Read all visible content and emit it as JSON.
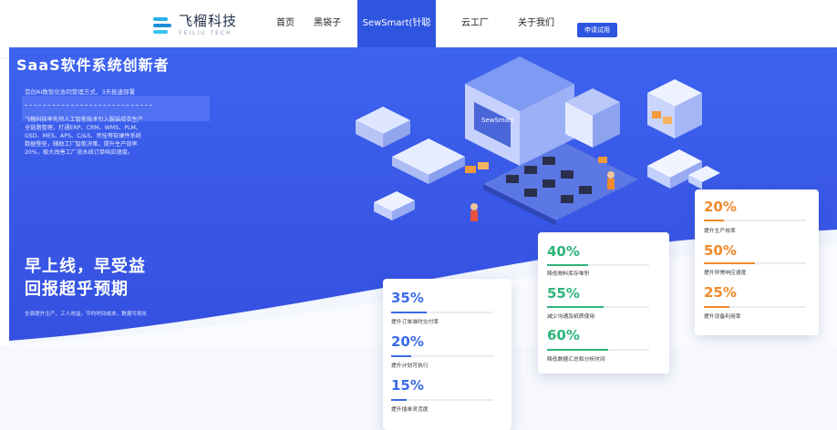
{
  "brand": {
    "name_cn": "飞榴科技",
    "name_en": "FEILIU TECH"
  },
  "nav": {
    "items": [
      "首页",
      "黑袋子",
      "SewSmart(针聪明)",
      "云工厂",
      "关于我们"
    ],
    "active": "SewSmart(针聪明)",
    "trial_button": "申请试用"
  },
  "hero": {
    "title": "SaaS软件系统创新者",
    "subtitle": "首创AI数智化协同管理方式，3天极速部署",
    "description": "飞榴科技率先将人工智能技术引入服装成衣生产全链路管理，打通ERP、CRM、WMS、PLM、GSD、MES、APS、C/&S、吊挂等软硬件系统数据壁垒，辅助工厂智能决策，提升生产效率20%，极大改善工厂流水线订单响应速度。",
    "slogan_line1": "早上线，早受益",
    "slogan_line2": "回报超乎预期",
    "bottom_text": "全面提升生产、工人效益，节约时间成本，数据可视化",
    "illustration_label": "SewSmart"
  },
  "cards": {
    "left": [
      {
        "value": "35%",
        "label": "提升订单准时交付率",
        "fill": 0.35,
        "color": "#3b6be6"
      },
      {
        "value": "20%",
        "label": "提升计划可执行",
        "fill": 0.2,
        "color": "#3b6be6"
      },
      {
        "value": "15%",
        "label": "提升插单灵活度",
        "fill": 0.15,
        "color": "#3b6be6"
      }
    ],
    "middle": [
      {
        "value": "40%",
        "label": "降低物料库存堆积",
        "fill": 0.4,
        "color": "#2fb47a"
      },
      {
        "value": "55%",
        "label": "减少沟通及纸质使用",
        "fill": 0.55,
        "color": "#2fb47a"
      },
      {
        "value": "60%",
        "label": "降低数据汇总和分析时间",
        "fill": 0.6,
        "color": "#2fb47a"
      }
    ],
    "right": [
      {
        "value": "20%",
        "label": "提升生产效率",
        "fill": 0.2,
        "color": "#f08a2a"
      },
      {
        "value": "50%",
        "label": "提升异常响应速度",
        "fill": 0.5,
        "color": "#f08a2a"
      },
      {
        "value": "25%",
        "label": "提升设备利用率",
        "fill": 0.25,
        "color": "#f08a2a"
      }
    ]
  }
}
